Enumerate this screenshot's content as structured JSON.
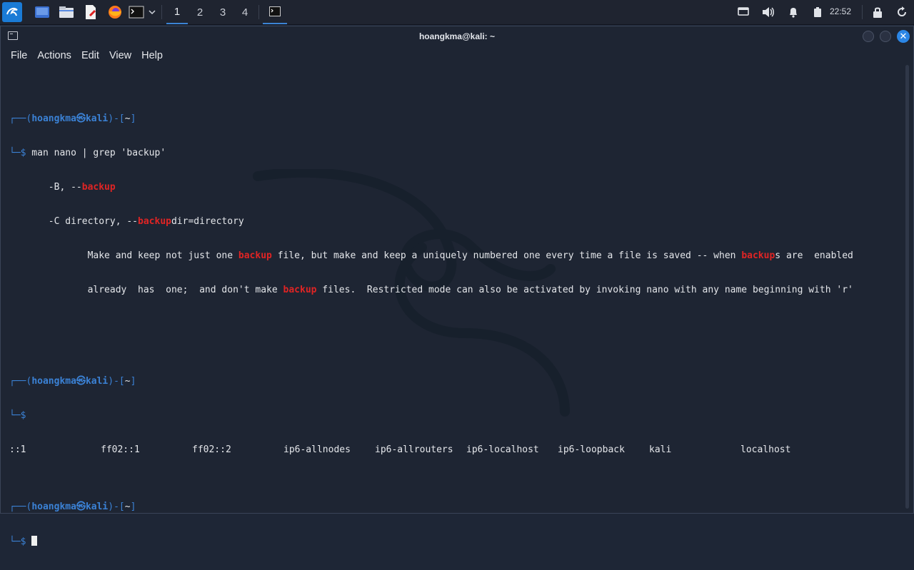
{
  "panel": {
    "workspaces": [
      "1",
      "2",
      "3",
      "4"
    ],
    "active_workspace": "1",
    "clock": "22:52",
    "accent_color": "#3c84d4"
  },
  "window": {
    "title": "hoangkma@kali: ~"
  },
  "menu": [
    "File",
    "Actions",
    "Edit",
    "View",
    "Help"
  ],
  "terminal": {
    "user": "hoangkma",
    "at_symbol": "㉿",
    "host": "kali",
    "dir": "~",
    "prompt_open": "┌──(",
    "prompt_mid": ")-[",
    "prompt_close": "]",
    "prompt_sym": "└─$",
    "command1": " man nano | grep 'backup'",
    "out1_pre": "       -B, --",
    "out2_pre": "       -C directory, --",
    "out2_post": "dir=directory",
    "out3_pre": "              Make and keep not just one ",
    "out3_mid": " file, but make and keep a uniquely numbered one every time a file is saved -- when ",
    "out3_post": "s are  enabled",
    "out4_pre": "              already  has  one;  and don't make ",
    "out4_post": " files.  Restricted mode can also be activated by invoking nano with any name beginning with 'r'",
    "highlight": "backup",
    "hosts_output": [
      "::1",
      "ff02::1",
      "ff02::2",
      "ip6-allnodes",
      "ip6-allrouters",
      "ip6-localhost",
      "ip6-loopback",
      "kali",
      "localhost"
    ]
  }
}
